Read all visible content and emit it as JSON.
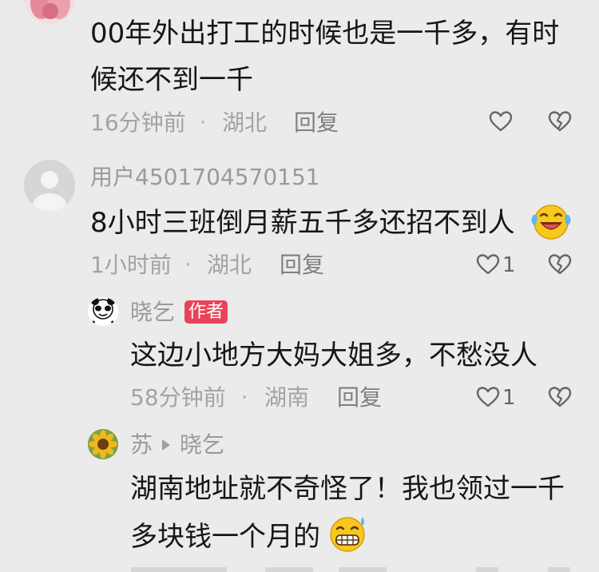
{
  "comments": [
    {
      "text_lines": [
        "00年外出打工的时候也是一千多，有时",
        "候还不到一千"
      ],
      "time": "16分钟前",
      "location": "湖北",
      "reply_label": "回复"
    },
    {
      "username": "用户4501704570151",
      "text": "8小时三班倒月薪五千多还招不到人",
      "emoji": "laughing-crying-emoji",
      "time": "1小时前",
      "location": "湖北",
      "reply_label": "回复",
      "likes": "1"
    },
    {
      "username": "晓乞",
      "badge": "作者",
      "text": "这边小地方大妈大姐多，不愁没人",
      "time": "58分钟前",
      "location": "湖南",
      "reply_label": "回复",
      "likes": "1"
    },
    {
      "username": "苏",
      "reply_to": "晓乞",
      "text_lines": [
        "湖南地址就不奇怪了！我也领过一千",
        "多块钱一个月的"
      ],
      "emoji": "grimacing-sweat-emoji"
    }
  ],
  "separator": "·",
  "icons": {
    "like": "heart-outline-icon",
    "dislike": "broken-heart-icon",
    "reply_arrow": "triangle-right-icon"
  }
}
